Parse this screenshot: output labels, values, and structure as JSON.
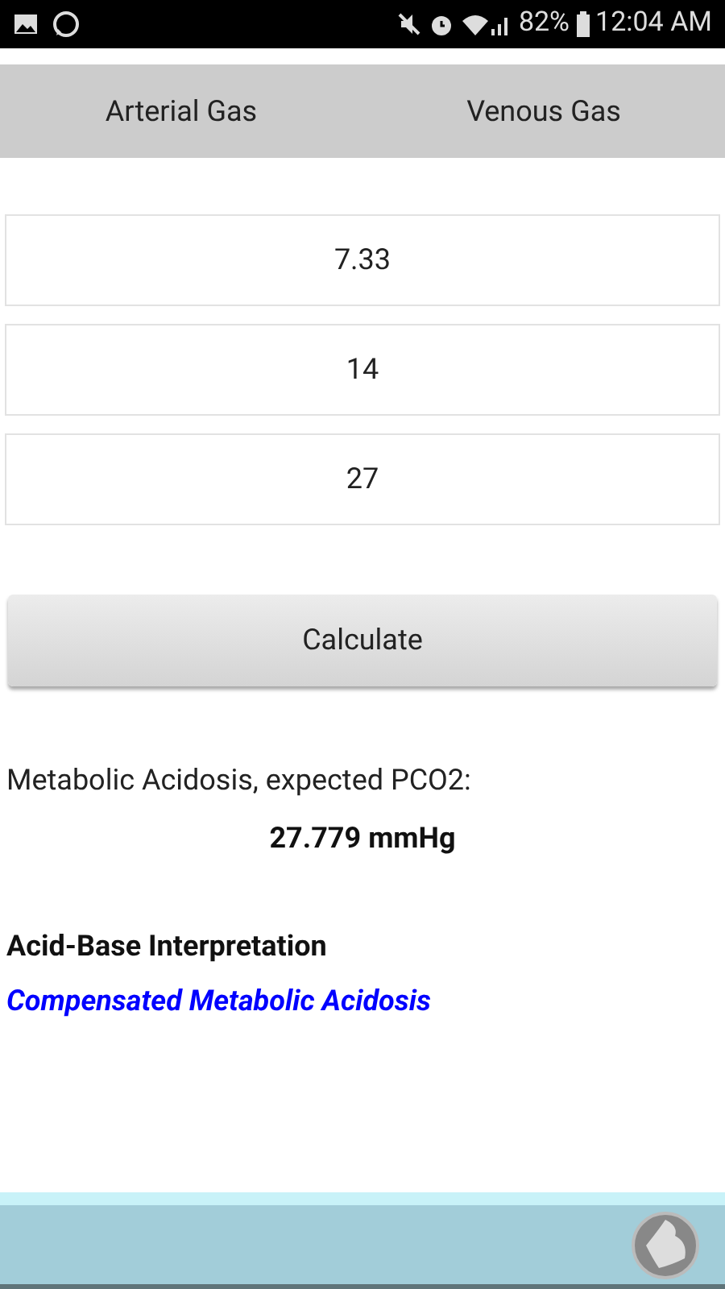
{
  "status_bar": {
    "battery": "82%",
    "time": "12:04 AM"
  },
  "tabs": [
    {
      "label": "Arterial Gas"
    },
    {
      "label": "Venous Gas"
    }
  ],
  "fields": [
    {
      "value": "7.33"
    },
    {
      "value": "14"
    },
    {
      "value": "27"
    }
  ],
  "calculate_button": "Calculate",
  "result": {
    "label": "Metabolic Acidosis, expected PCO2:",
    "value": "27.779 mmHg"
  },
  "interpretation": {
    "heading": "Acid-Base Interpretation",
    "text": "Compensated Metabolic Acidosis"
  }
}
